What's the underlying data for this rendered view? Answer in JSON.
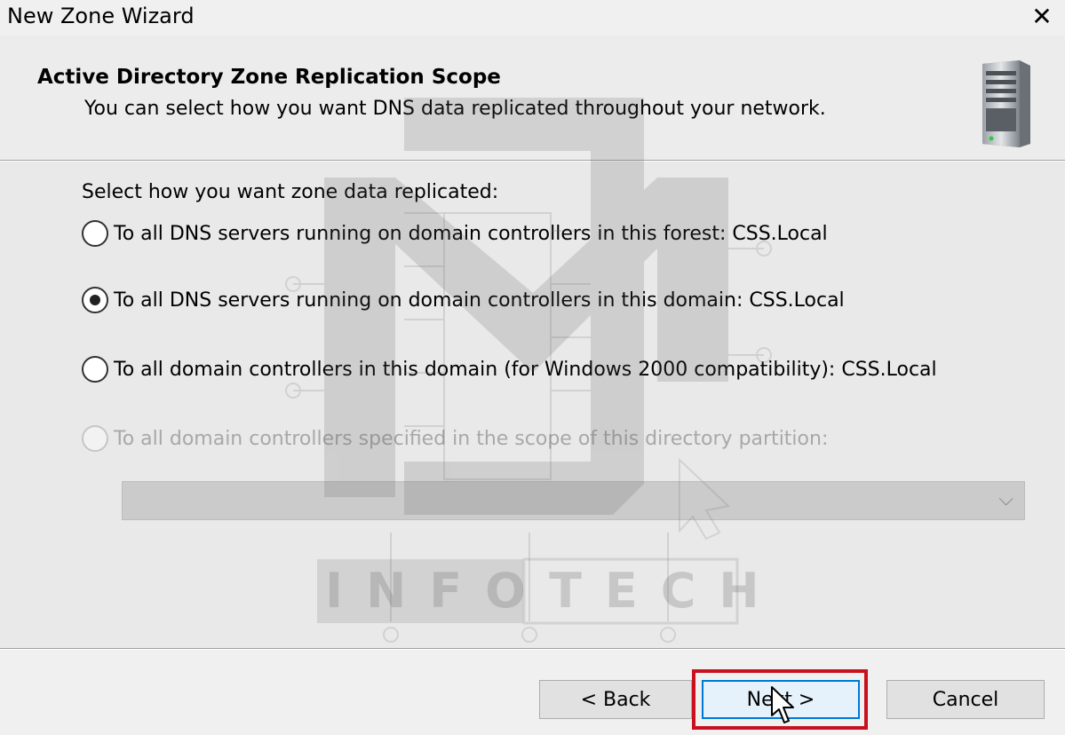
{
  "window": {
    "title": "New Zone Wizard",
    "close_glyph": "✕"
  },
  "header": {
    "title": "Active Directory Zone Replication Scope",
    "subtitle": "You can select how you want DNS data replicated throughout your network.",
    "icon": "server-icon"
  },
  "content": {
    "prompt": "Select how you want zone data replicated:",
    "options": [
      {
        "label": "To all DNS servers running on domain controllers in this forest: CSS.Local",
        "checked": false,
        "enabled": true
      },
      {
        "label": "To all DNS servers running on domain controllers in this domain: CSS.Local",
        "checked": true,
        "enabled": true
      },
      {
        "label": "To all domain controllers in this domain (for Windows 2000 compatibility): CSS.Local",
        "checked": false,
        "enabled": true
      },
      {
        "label": "To all domain controllers specified in the scope of this directory partition:",
        "checked": false,
        "enabled": false
      }
    ],
    "partition_dropdown": {
      "value": "",
      "enabled": false,
      "icon": "chevron-down-icon"
    }
  },
  "footer": {
    "back_label": "< Back",
    "next_label": "Next >",
    "cancel_label": "Cancel"
  },
  "watermark": {
    "text": "INFOTECH"
  },
  "colors": {
    "highlight": "#c8101e",
    "focus_border": "#0078d7"
  }
}
